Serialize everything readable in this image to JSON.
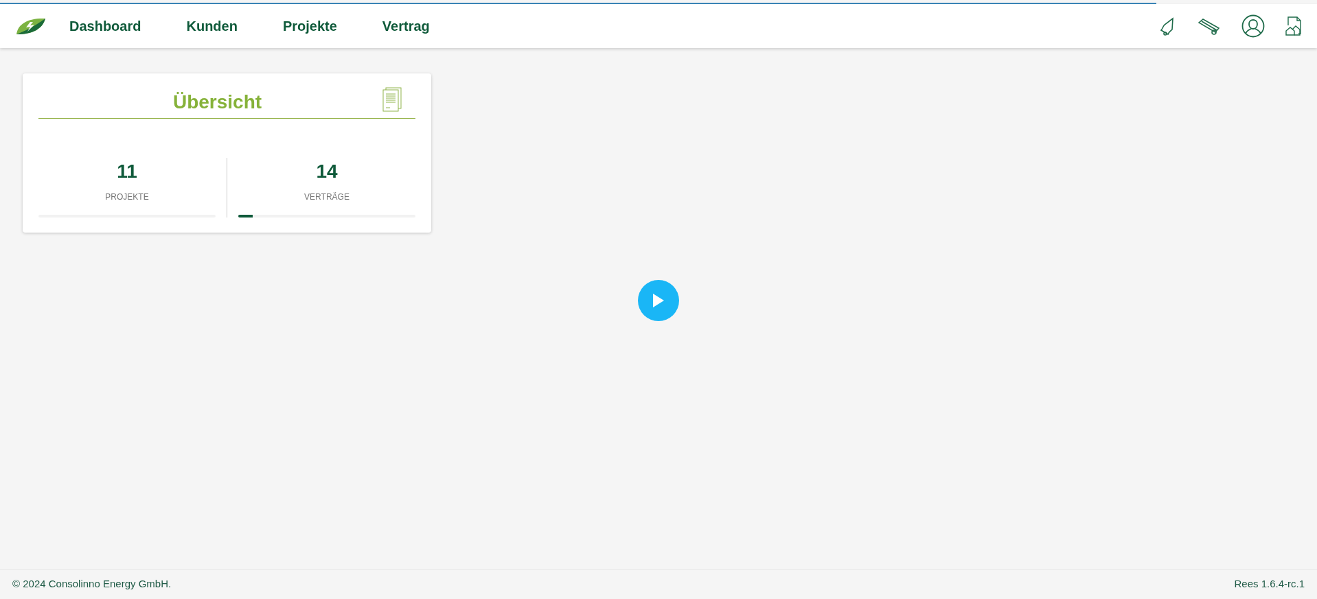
{
  "loading_bar": {
    "level": 0.878
  },
  "nav": {
    "items": [
      {
        "label": "Dashboard"
      },
      {
        "label": "Kunden"
      },
      {
        "label": "Projekte"
      },
      {
        "label": "Vertrag"
      }
    ]
  },
  "overview_card": {
    "title": "Übersicht",
    "stats": [
      {
        "value": "11",
        "label": "PROJEKTE",
        "level": 0
      },
      {
        "value": "14",
        "label": "VERTRÄGE",
        "level": 0.08
      }
    ]
  },
  "footer": {
    "copyright": "© 2024 Consolinno Energy GmbH.",
    "version": "Rees 1.6.4-rc.1"
  }
}
